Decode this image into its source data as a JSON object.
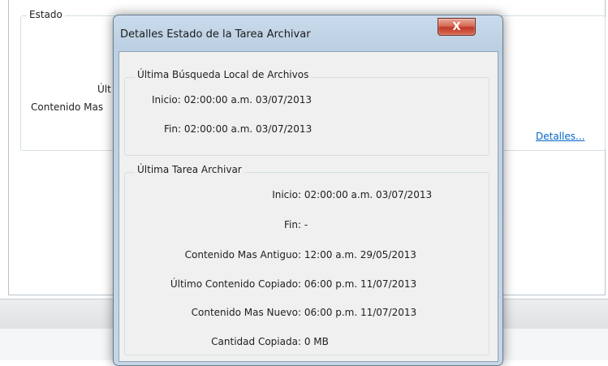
{
  "background": {
    "group_label": "Estado",
    "label_ultima_partial": "Últ",
    "label_contenido_partial": "Contenido Mas",
    "details_link": "Detalles..."
  },
  "dialog": {
    "title": "Detalles Estado de la Tarea Archivar",
    "close_label": "X",
    "search_group": {
      "title": "Última Búsqueda Local de Archivos",
      "start_label": "Inicio:",
      "start_value": "02:00:00 a.m. 03/07/2013",
      "end_label": "Fin:",
      "end_value": "02:00:00 a.m. 03/07/2013"
    },
    "archive_group": {
      "title": "Última Tarea Archivar",
      "rows": [
        {
          "label": "Inicio:",
          "value": "02:00:00 a.m. 03/07/2013"
        },
        {
          "label": "Fin:",
          "value": "-"
        },
        {
          "label": "Contenido Mas Antiguo:",
          "value": "12:00 a.m. 29/05/2013"
        },
        {
          "label": "Último Contenido Copiado:",
          "value": "06:00 p.m. 11/07/2013"
        },
        {
          "label": "Contenido Mas Nuevo:",
          "value": "06:00 p.m. 11/07/2013"
        },
        {
          "label": "Cantidad Copiada:",
          "value": "0 MB"
        }
      ]
    }
  }
}
